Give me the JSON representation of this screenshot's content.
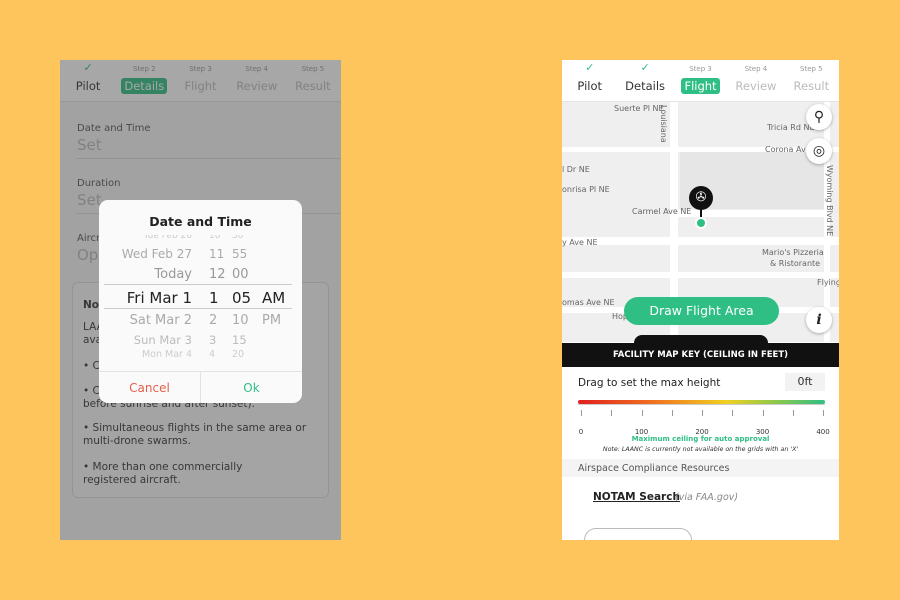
{
  "colors": {
    "background": "#fdc55c",
    "accent": "#2fbf85",
    "cancel": "#e5604f"
  },
  "left": {
    "steps": [
      {
        "top": "✓",
        "label": "Pilot",
        "state": "done"
      },
      {
        "top": "Step 2",
        "label": "Details",
        "state": "active"
      },
      {
        "top": "Step 3",
        "label": "Flight",
        "state": "todo"
      },
      {
        "top": "Step 4",
        "label": "Review",
        "state": "todo"
      },
      {
        "top": "Step 5",
        "label": "Result",
        "state": "todo"
      }
    ],
    "date_label": "Date and Time",
    "date_value": "Set",
    "duration_label": "Duration",
    "duration_value": "Set",
    "aircraft_label": "Aircr",
    "aircraft_value": "Op",
    "notes": {
      "title": "Not",
      "line1a": "LAA",
      "line1b": "ava",
      "bullet1": "• C",
      "bullet2": "• C",
      "bullet2_cont": "before sunrise and after sunset).",
      "bullet3": "• Simultaneous flights in the same area or multi-drone swarms.",
      "bullet4": "• More than one commercially registered aircraft."
    },
    "modal": {
      "title": "Date and Time",
      "rows": [
        {
          "day": "Tue Feb 26",
          "hour": "10",
          "min": "50",
          "ampm": ""
        },
        {
          "day": "Wed Feb 27",
          "hour": "11",
          "min": "55",
          "ampm": ""
        },
        {
          "day": "Today",
          "hour": "12",
          "min": "00",
          "ampm": ""
        },
        {
          "day": "Fri Mar 1",
          "hour": "1",
          "min": "05",
          "ampm": "AM"
        },
        {
          "day": "Sat Mar 2",
          "hour": "2",
          "min": "10",
          "ampm": "PM"
        },
        {
          "day": "Sun Mar 3",
          "hour": "3",
          "min": "15",
          "ampm": ""
        },
        {
          "day": "Mon Mar 4",
          "hour": "4",
          "min": "20",
          "ampm": ""
        }
      ],
      "cancel": "Cancel",
      "ok": "Ok"
    }
  },
  "right": {
    "steps": [
      {
        "top": "✓",
        "label": "Pilot",
        "state": "done"
      },
      {
        "top": "✓",
        "label": "Details",
        "state": "done"
      },
      {
        "top": "Step 3",
        "label": "Flight",
        "state": "active"
      },
      {
        "top": "Step 4",
        "label": "Review",
        "state": "todo"
      },
      {
        "top": "Step 5",
        "label": "Result",
        "state": "todo"
      }
    ],
    "map": {
      "streets": [
        "Suerte Pl NE",
        "Louisiana",
        "Tricia Rd NE",
        "Corona Ave",
        "l Dr NE",
        "onrisa Pl NE",
        "Carmel Ave NE",
        "y Ave NE",
        "Wyoming Blvd NE",
        "Mario's Pizzeria",
        "& Ristorante",
        "Flying",
        "omas Ave NE",
        "Hop"
      ],
      "icons": [
        "search-icon",
        "locate-icon",
        "info-icon",
        "drone-pin-icon"
      ]
    },
    "draw_button": "Draw Flight Area",
    "key_title": "FACILITY MAP  KEY (CEILING IN FEET)",
    "drag_label": "Drag to set the max height",
    "height_value": "0ft",
    "slider_value_ft": 0,
    "scale_ticks": [
      "0",
      "100",
      "200",
      "300",
      "400"
    ],
    "max_ceiling": "Maximum ceiling for auto approval",
    "note": "Note: LAANC is currently not available on the grids with an 'X'",
    "resources_title": "Airspace Compliance Resources",
    "notam_link": "NOTAM Search",
    "notam_via": "(via FAA.gov)"
  }
}
